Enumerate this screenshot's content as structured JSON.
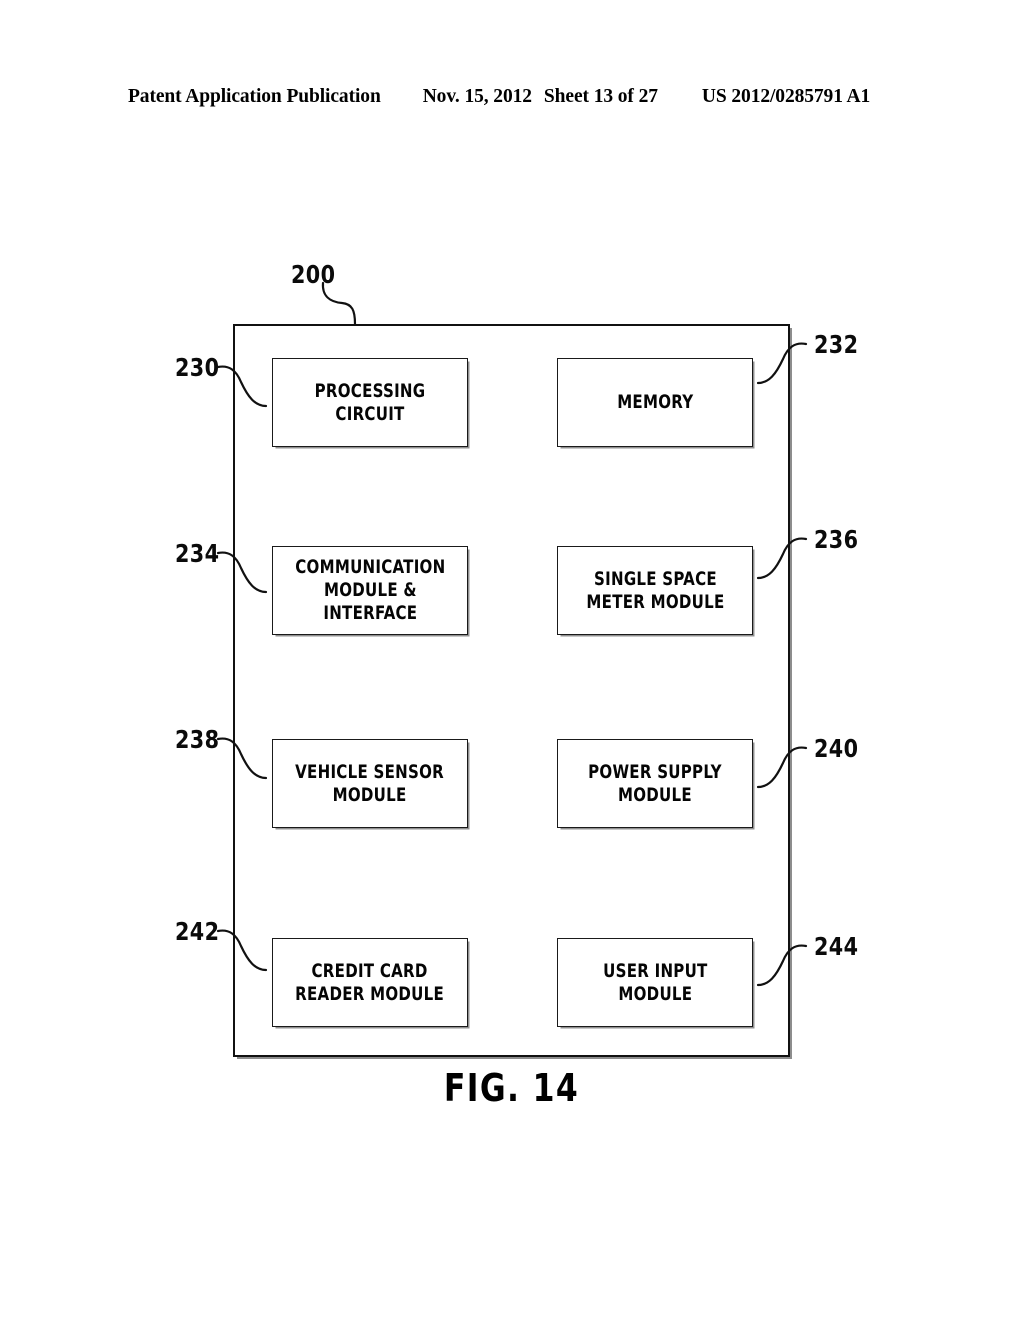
{
  "header": {
    "publication": "Patent Application Publication",
    "date": "Nov. 15, 2012",
    "sheet": "Sheet 13 of 27",
    "patent_number": "US 2012/0285791 A1"
  },
  "figure": {
    "caption": "FIG. 14",
    "container_ref": "200",
    "modules": [
      {
        "ref": "230",
        "label": "PROCESSING CIRCUIT",
        "side": "left"
      },
      {
        "ref": "232",
        "label": "MEMORY",
        "side": "right"
      },
      {
        "ref": "234",
        "label": "COMMUNICATION\nMODULE &\nINTERFACE",
        "side": "left"
      },
      {
        "ref": "236",
        "label": "SINGLE SPACE\nMETER MODULE",
        "side": "right"
      },
      {
        "ref": "238",
        "label": "VEHICLE SENSOR\nMODULE",
        "side": "left"
      },
      {
        "ref": "240",
        "label": "POWER SUPPLY\nMODULE",
        "side": "right"
      },
      {
        "ref": "242",
        "label": "CREDIT CARD\nREADER MODULE",
        "side": "left"
      },
      {
        "ref": "244",
        "label": "USER INPUT\nMODULE",
        "side": "right"
      }
    ]
  }
}
